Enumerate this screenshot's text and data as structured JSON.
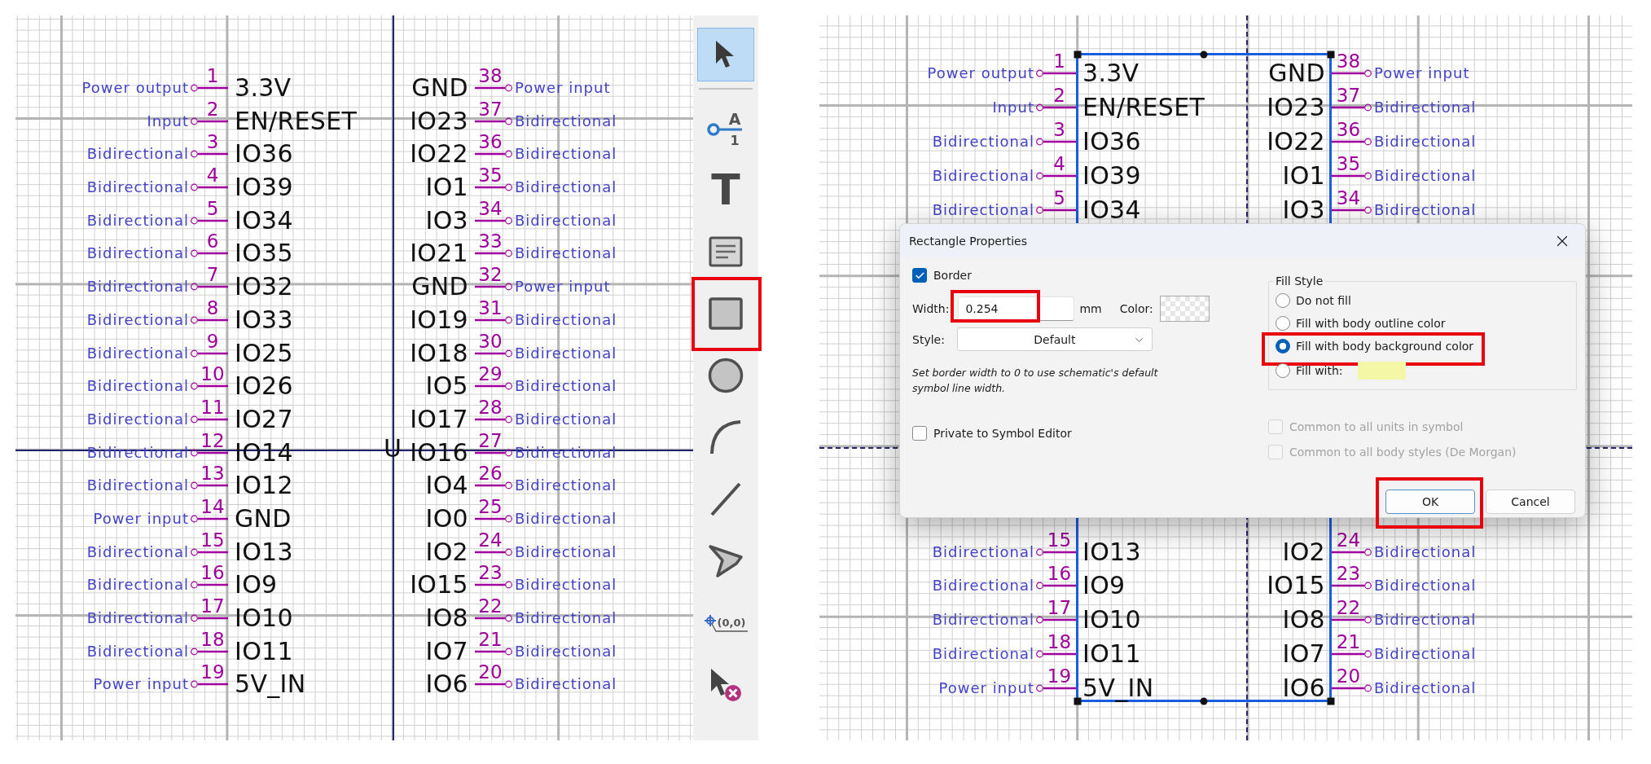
{
  "left_view": {
    "reference": "U",
    "pins": [
      {
        "left": {
          "type": "Power output",
          "number": "1",
          "name": "3.3V"
        },
        "right": {
          "name": "GND",
          "number": "38",
          "type": "Power input"
        }
      },
      {
        "left": {
          "type": "Input",
          "number": "2",
          "name": "EN/RESET"
        },
        "right": {
          "name": "IO23",
          "number": "37",
          "type": "Bidirectional"
        }
      },
      {
        "left": {
          "type": "Bidirectional",
          "number": "3",
          "name": "IO36"
        },
        "right": {
          "name": "IO22",
          "number": "36",
          "type": "Bidirectional"
        }
      },
      {
        "left": {
          "type": "Bidirectional",
          "number": "4",
          "name": "IO39"
        },
        "right": {
          "name": "IO1",
          "number": "35",
          "type": "Bidirectional"
        }
      },
      {
        "left": {
          "type": "Bidirectional",
          "number": "5",
          "name": "IO34"
        },
        "right": {
          "name": "IO3",
          "number": "34",
          "type": "Bidirectional"
        }
      },
      {
        "left": {
          "type": "Bidirectional",
          "number": "6",
          "name": "IO35"
        },
        "right": {
          "name": "IO21",
          "number": "33",
          "type": "Bidirectional"
        }
      },
      {
        "left": {
          "type": "Bidirectional",
          "number": "7",
          "name": "IO32"
        },
        "right": {
          "name": "GND",
          "number": "32",
          "type": "Power input"
        }
      },
      {
        "left": {
          "type": "Bidirectional",
          "number": "8",
          "name": "IO33"
        },
        "right": {
          "name": "IO19",
          "number": "31",
          "type": "Bidirectional"
        }
      },
      {
        "left": {
          "type": "Bidirectional",
          "number": "9",
          "name": "IO25"
        },
        "right": {
          "name": "IO18",
          "number": "30",
          "type": "Bidirectional"
        }
      },
      {
        "left": {
          "type": "Bidirectional",
          "number": "10",
          "name": "IO26"
        },
        "right": {
          "name": "IO5",
          "number": "29",
          "type": "Bidirectional"
        }
      },
      {
        "left": {
          "type": "Bidirectional",
          "number": "11",
          "name": "IO27"
        },
        "right": {
          "name": "IO17",
          "number": "28",
          "type": "Bidirectional"
        }
      },
      {
        "left": {
          "type": "Bidirectional",
          "number": "12",
          "name": "IO14"
        },
        "right": {
          "name": "IO16",
          "number": "27",
          "type": "Bidirectional"
        }
      },
      {
        "left": {
          "type": "Bidirectional",
          "number": "13",
          "name": "IO12"
        },
        "right": {
          "name": "IO4",
          "number": "26",
          "type": "Bidirectional"
        }
      },
      {
        "left": {
          "type": "Power input",
          "number": "14",
          "name": "GND"
        },
        "right": {
          "name": "IO0",
          "number": "25",
          "type": "Bidirectional"
        }
      },
      {
        "left": {
          "type": "Bidirectional",
          "number": "15",
          "name": "IO13"
        },
        "right": {
          "name": "IO2",
          "number": "24",
          "type": "Bidirectional"
        }
      },
      {
        "left": {
          "type": "Bidirectional",
          "number": "16",
          "name": "IO9"
        },
        "right": {
          "name": "IO15",
          "number": "23",
          "type": "Bidirectional"
        }
      },
      {
        "left": {
          "type": "Bidirectional",
          "number": "17",
          "name": "IO10"
        },
        "right": {
          "name": "IO8",
          "number": "22",
          "type": "Bidirectional"
        }
      },
      {
        "left": {
          "type": "Bidirectional",
          "number": "18",
          "name": "IO11"
        },
        "right": {
          "name": "IO7",
          "number": "21",
          "type": "Bidirectional"
        }
      },
      {
        "left": {
          "type": "Power input",
          "number": "19",
          "name": "5V_IN"
        },
        "right": {
          "name": "IO6",
          "number": "20",
          "type": "Bidirectional"
        }
      }
    ]
  },
  "toolbar": {
    "tools": [
      {
        "kind": "select",
        "selected": true,
        "highlighted": false
      },
      {
        "kind": "pin",
        "label": "A",
        "number": "1",
        "selected": false,
        "highlighted": false
      },
      {
        "kind": "text",
        "label": "T",
        "selected": false,
        "highlighted": false
      },
      {
        "kind": "textbox",
        "selected": false,
        "highlighted": false
      },
      {
        "kind": "rectangle",
        "selected": false,
        "highlighted": true
      },
      {
        "kind": "circle",
        "selected": false,
        "highlighted": false
      },
      {
        "kind": "arc",
        "selected": false,
        "highlighted": false
      },
      {
        "kind": "line",
        "selected": false,
        "highlighted": false
      },
      {
        "kind": "polygon",
        "selected": false,
        "highlighted": false
      },
      {
        "kind": "anchor",
        "label": "(0,0)",
        "selected": false,
        "highlighted": false
      },
      {
        "kind": "delete",
        "selected": false,
        "highlighted": false
      }
    ]
  },
  "right_view": {
    "top_pins": [
      {
        "left": {
          "type": "Power output",
          "number": "1",
          "name": "3.3V"
        },
        "right": {
          "name": "GND",
          "number": "38",
          "type": "Power input"
        }
      },
      {
        "left": {
          "type": "Input",
          "number": "2",
          "name": "EN/RESET"
        },
        "right": {
          "name": "IO23",
          "number": "37",
          "type": "Bidirectional"
        }
      },
      {
        "left": {
          "type": "Bidirectional",
          "number": "3",
          "name": "IO36"
        },
        "right": {
          "name": "IO22",
          "number": "36",
          "type": "Bidirectional"
        }
      },
      {
        "left": {
          "type": "Bidirectional",
          "number": "4",
          "name": "IO39"
        },
        "right": {
          "name": "IO1",
          "number": "35",
          "type": "Bidirectional"
        }
      },
      {
        "left": {
          "type": "Bidirectional",
          "number": "5",
          "name": "IO34"
        },
        "right": {
          "name": "IO3",
          "number": "34",
          "type": "Bidirectional"
        }
      }
    ],
    "bottom_pins": [
      {
        "left": {
          "type": "Bidirectional",
          "number": "15",
          "name": "IO13"
        },
        "right": {
          "name": "IO2",
          "number": "24",
          "type": "Bidirectional"
        }
      },
      {
        "left": {
          "type": "Bidirectional",
          "number": "16",
          "name": "IO9"
        },
        "right": {
          "name": "IO15",
          "number": "23",
          "type": "Bidirectional"
        }
      },
      {
        "left": {
          "type": "Bidirectional",
          "number": "17",
          "name": "IO10"
        },
        "right": {
          "name": "IO8",
          "number": "22",
          "type": "Bidirectional"
        }
      },
      {
        "left": {
          "type": "Bidirectional",
          "number": "18",
          "name": "IO11"
        },
        "right": {
          "name": "IO7",
          "number": "21",
          "type": "Bidirectional"
        }
      },
      {
        "left": {
          "type": "Power input",
          "number": "19",
          "name": "5V_IN"
        },
        "right": {
          "name": "IO6",
          "number": "20",
          "type": "Bidirectional"
        }
      }
    ],
    "dialog": {
      "title": "Rectangle Properties",
      "border": {
        "label": "Border",
        "checked": true
      },
      "width": {
        "label": "Width:",
        "value": "0.254",
        "unit": "mm",
        "highlighted": true
      },
      "color": {
        "label": "Color:"
      },
      "style": {
        "label": "Style:",
        "value": "Default"
      },
      "note": "Set border width to 0 to use schematic's default symbol line width.",
      "private": {
        "label": "Private to Symbol Editor",
        "checked": false
      },
      "fill_style": {
        "title": "Fill Style",
        "options": [
          {
            "kind": "plain",
            "label": "Do not fill",
            "selected": false,
            "highlighted": false
          },
          {
            "kind": "plain",
            "label": "Fill with body outline color",
            "selected": false,
            "highlighted": false
          },
          {
            "kind": "plain",
            "label": "Fill with body background color",
            "selected": true,
            "highlighted": true
          },
          {
            "kind": "swatch",
            "label": "Fill with:",
            "selected": false,
            "highlighted": false
          }
        ]
      },
      "common": [
        {
          "label": "Common to all units in symbol",
          "checked": false,
          "disabled": true
        },
        {
          "label": "Common to all body styles (De Morgan)",
          "checked": false,
          "disabled": true
        }
      ],
      "buttons": [
        {
          "label": "OK",
          "default": true,
          "highlighted": true
        },
        {
          "label": "Cancel",
          "default": false,
          "highlighted": false
        }
      ]
    }
  }
}
